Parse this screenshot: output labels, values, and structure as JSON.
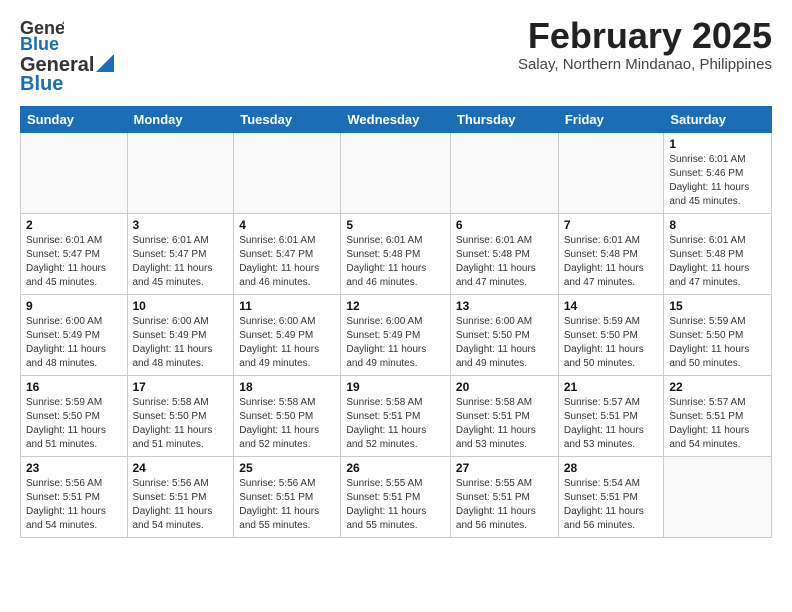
{
  "header": {
    "logo_general": "General",
    "logo_blue": "Blue",
    "title": "February 2025",
    "subtitle": "Salay, Northern Mindanao, Philippines"
  },
  "weekdays": [
    "Sunday",
    "Monday",
    "Tuesday",
    "Wednesday",
    "Thursday",
    "Friday",
    "Saturday"
  ],
  "weeks": [
    [
      {
        "day": "",
        "info": ""
      },
      {
        "day": "",
        "info": ""
      },
      {
        "day": "",
        "info": ""
      },
      {
        "day": "",
        "info": ""
      },
      {
        "day": "",
        "info": ""
      },
      {
        "day": "",
        "info": ""
      },
      {
        "day": "1",
        "info": "Sunrise: 6:01 AM\nSunset: 5:46 PM\nDaylight: 11 hours and 45 minutes."
      }
    ],
    [
      {
        "day": "2",
        "info": "Sunrise: 6:01 AM\nSunset: 5:47 PM\nDaylight: 11 hours and 45 minutes."
      },
      {
        "day": "3",
        "info": "Sunrise: 6:01 AM\nSunset: 5:47 PM\nDaylight: 11 hours and 45 minutes."
      },
      {
        "day": "4",
        "info": "Sunrise: 6:01 AM\nSunset: 5:47 PM\nDaylight: 11 hours and 46 minutes."
      },
      {
        "day": "5",
        "info": "Sunrise: 6:01 AM\nSunset: 5:48 PM\nDaylight: 11 hours and 46 minutes."
      },
      {
        "day": "6",
        "info": "Sunrise: 6:01 AM\nSunset: 5:48 PM\nDaylight: 11 hours and 47 minutes."
      },
      {
        "day": "7",
        "info": "Sunrise: 6:01 AM\nSunset: 5:48 PM\nDaylight: 11 hours and 47 minutes."
      },
      {
        "day": "8",
        "info": "Sunrise: 6:01 AM\nSunset: 5:48 PM\nDaylight: 11 hours and 47 minutes."
      }
    ],
    [
      {
        "day": "9",
        "info": "Sunrise: 6:00 AM\nSunset: 5:49 PM\nDaylight: 11 hours and 48 minutes."
      },
      {
        "day": "10",
        "info": "Sunrise: 6:00 AM\nSunset: 5:49 PM\nDaylight: 11 hours and 48 minutes."
      },
      {
        "day": "11",
        "info": "Sunrise: 6:00 AM\nSunset: 5:49 PM\nDaylight: 11 hours and 49 minutes."
      },
      {
        "day": "12",
        "info": "Sunrise: 6:00 AM\nSunset: 5:49 PM\nDaylight: 11 hours and 49 minutes."
      },
      {
        "day": "13",
        "info": "Sunrise: 6:00 AM\nSunset: 5:50 PM\nDaylight: 11 hours and 49 minutes."
      },
      {
        "day": "14",
        "info": "Sunrise: 5:59 AM\nSunset: 5:50 PM\nDaylight: 11 hours and 50 minutes."
      },
      {
        "day": "15",
        "info": "Sunrise: 5:59 AM\nSunset: 5:50 PM\nDaylight: 11 hours and 50 minutes."
      }
    ],
    [
      {
        "day": "16",
        "info": "Sunrise: 5:59 AM\nSunset: 5:50 PM\nDaylight: 11 hours and 51 minutes."
      },
      {
        "day": "17",
        "info": "Sunrise: 5:58 AM\nSunset: 5:50 PM\nDaylight: 11 hours and 51 minutes."
      },
      {
        "day": "18",
        "info": "Sunrise: 5:58 AM\nSunset: 5:50 PM\nDaylight: 11 hours and 52 minutes."
      },
      {
        "day": "19",
        "info": "Sunrise: 5:58 AM\nSunset: 5:51 PM\nDaylight: 11 hours and 52 minutes."
      },
      {
        "day": "20",
        "info": "Sunrise: 5:58 AM\nSunset: 5:51 PM\nDaylight: 11 hours and 53 minutes."
      },
      {
        "day": "21",
        "info": "Sunrise: 5:57 AM\nSunset: 5:51 PM\nDaylight: 11 hours and 53 minutes."
      },
      {
        "day": "22",
        "info": "Sunrise: 5:57 AM\nSunset: 5:51 PM\nDaylight: 11 hours and 54 minutes."
      }
    ],
    [
      {
        "day": "23",
        "info": "Sunrise: 5:56 AM\nSunset: 5:51 PM\nDaylight: 11 hours and 54 minutes."
      },
      {
        "day": "24",
        "info": "Sunrise: 5:56 AM\nSunset: 5:51 PM\nDaylight: 11 hours and 54 minutes."
      },
      {
        "day": "25",
        "info": "Sunrise: 5:56 AM\nSunset: 5:51 PM\nDaylight: 11 hours and 55 minutes."
      },
      {
        "day": "26",
        "info": "Sunrise: 5:55 AM\nSunset: 5:51 PM\nDaylight: 11 hours and 55 minutes."
      },
      {
        "day": "27",
        "info": "Sunrise: 5:55 AM\nSunset: 5:51 PM\nDaylight: 11 hours and 56 minutes."
      },
      {
        "day": "28",
        "info": "Sunrise: 5:54 AM\nSunset: 5:51 PM\nDaylight: 11 hours and 56 minutes."
      },
      {
        "day": "",
        "info": ""
      }
    ]
  ]
}
